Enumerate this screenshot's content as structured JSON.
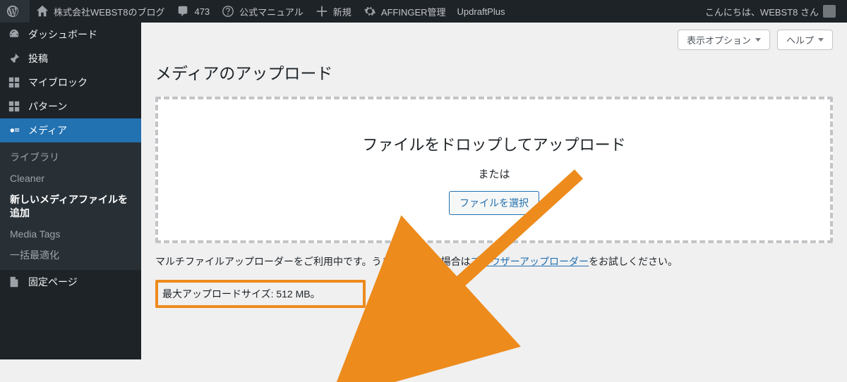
{
  "adminbar": {
    "site_title": "株式会社WEBST8のブログ",
    "comments_count": "473",
    "manual_label": "公式マニュアル",
    "new_label": "新規",
    "affinger_label": "AFFINGER管理",
    "updraft_label": "UpdraftPlus",
    "greeting": "こんにちは、WEBST8 さん"
  },
  "sidebar": {
    "dashboard": "ダッシュボード",
    "posts": "投稿",
    "myblock": "マイブロック",
    "pattern": "パターン",
    "media": "メディア",
    "media_sub": {
      "library": "ライブラリ",
      "cleaner": "Cleaner",
      "add_new": "新しいメディアファイルを追加",
      "media_tags": "Media Tags",
      "bulk_optimize": "一括最適化"
    },
    "pages": "固定ページ"
  },
  "screen_options": {
    "options_label": "表示オプション",
    "help_label": "ヘルプ"
  },
  "content": {
    "page_title": "メディアのアップロード",
    "drop_text": "ファイルをドロップしてアップロード",
    "or_text": "または",
    "select_button": "ファイルを選択",
    "helper_pre": "マルチファイルアップローダーをご利用中です。うまくいかない場合は",
    "helper_link": "ブラウザーアップローダー",
    "helper_post": "をお試しください。",
    "max_upload": "最大アップロードサイズ: 512 MB。"
  }
}
